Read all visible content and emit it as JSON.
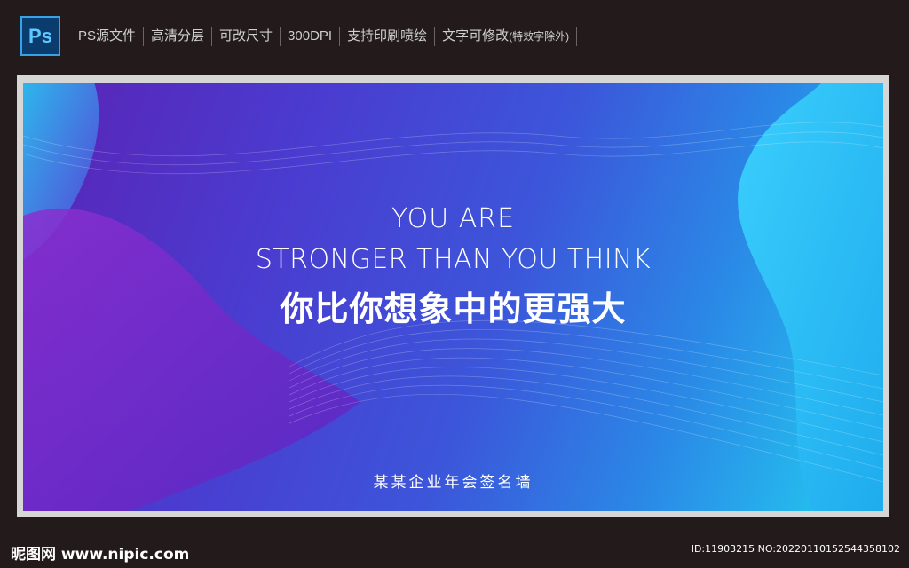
{
  "topbar": {
    "logo_text": "Ps",
    "features": [
      "PS源文件",
      "高清分层",
      "可改尺寸",
      "300DPI",
      "支持印刷喷绘"
    ],
    "last_feature_main": "文字可修改",
    "last_feature_note": "(特效字除外)"
  },
  "poster": {
    "line1": "YOU ARE",
    "line2": "STRONGER THAN YOU  THINK",
    "line3": "你比你想象中的更强大",
    "subtitle": "某某企业年会签名墙"
  },
  "footer": {
    "site": "昵图网 www.nipic.com",
    "id_text": "ID:11903215 NO:20220110152544358102"
  },
  "colors": {
    "page_bg": "#231a1b",
    "poster_start": "#5a23b5",
    "poster_end": "#22d0f0"
  }
}
